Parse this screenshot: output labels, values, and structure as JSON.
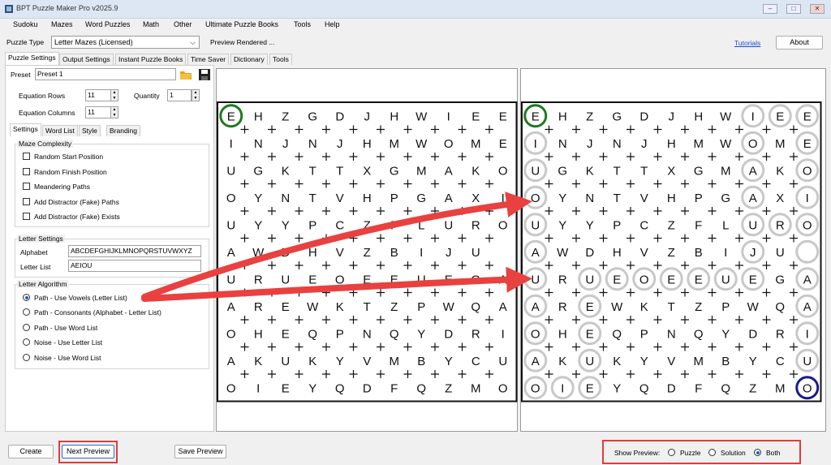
{
  "window": {
    "title": "BPT Puzzle Maker Pro v2025.9",
    "minimize": "‒",
    "maximize": "□",
    "close": "✕"
  },
  "menu": [
    "Sudoku",
    "Mazes",
    "Word Puzzles",
    "Math",
    "Other",
    "Ultimate Puzzle Books",
    "Tools",
    "Help"
  ],
  "toolbar": {
    "puzzle_type_label": "Puzzle Type",
    "puzzle_type_value": "Letter Mazes (Licensed)",
    "status": "Preview Rendered ...",
    "tutorials": "Tutorials",
    "about": "About"
  },
  "main_tabs": [
    "Puzzle Settings",
    "Output Settings",
    "Instant Puzzle Books",
    "Time Saver",
    "Dictionary",
    "Tools"
  ],
  "preset": {
    "label": "Preset",
    "value": "Preset 1"
  },
  "equation": {
    "rows_label": "Equation Rows",
    "rows": "11",
    "cols_label": "Equation Columns",
    "cols": "11",
    "quantity_label": "Quantity",
    "quantity": "1"
  },
  "sub_tabs": [
    "Settings",
    "Word List",
    "Style",
    "Branding"
  ],
  "maze_complexity": {
    "title": "Maze Complexity",
    "options": [
      "Random Start Position",
      "Random Finish Position",
      "Meandering Paths",
      "Add Distractor (Fake) Paths",
      "Add Distractor (Fake) Exists"
    ]
  },
  "letter_settings": {
    "title": "Letter Settings",
    "alphabet_label": "Alphabet",
    "alphabet": "ABCDEFGHIJKLMNOPQRSTUVWXYZ",
    "letter_list_label": "Letter List",
    "letter_list": "AEIOU"
  },
  "letter_algorithm": {
    "title": "Letter Algorithm",
    "options": [
      "Path - Use Vowels (Letter List)",
      "Path - Consonants (Alphabet - Letter List)",
      "Path - Use Word List",
      "Noise - Use Letter List",
      "Noise - Use Word List"
    ],
    "selected": 0
  },
  "bottom": {
    "create": "Create",
    "next_preview": "Next Preview",
    "save_preview": "Save Preview",
    "show_preview_label": "Show Preview:",
    "preview_options": [
      "Puzzle",
      "Solution",
      "Both"
    ],
    "preview_selected": 2
  },
  "grid": [
    "EHZGDJHWIEE",
    "INJNJHMWOME",
    "UGKTTXGMAKO",
    "OYNTVHPGAXI",
    "UYYPCZFLURO",
    "AWDHVZBIJU ",
    "URUEOEEUEGA",
    "AREWKTZPWQA",
    "OHEQPNQYDRI",
    "AKUKYVMBYCU",
    "OIEYQDFQZMO"
  ],
  "solution_path": [
    [
      0,
      0
    ],
    [
      1,
      0
    ],
    [
      2,
      0
    ],
    [
      3,
      0
    ],
    [
      4,
      0
    ],
    [
      5,
      0
    ],
    [
      6,
      0
    ],
    [
      7,
      0
    ],
    [
      8,
      0
    ],
    [
      9,
      0
    ],
    [
      10,
      0
    ],
    [
      10,
      1
    ],
    [
      10,
      2
    ],
    [
      9,
      2
    ],
    [
      8,
      2
    ],
    [
      7,
      2
    ],
    [
      6,
      2
    ],
    [
      6,
      3
    ],
    [
      6,
      4
    ],
    [
      6,
      5
    ],
    [
      6,
      6
    ],
    [
      6,
      7
    ],
    [
      6,
      8
    ],
    [
      5,
      8
    ],
    [
      4,
      8
    ],
    [
      4,
      9
    ],
    [
      3,
      8
    ],
    [
      2,
      8
    ],
    [
      1,
      8
    ],
    [
      0,
      8
    ],
    [
      0,
      9
    ],
    [
      0,
      10
    ],
    [
      1,
      10
    ],
    [
      2,
      10
    ],
    [
      3,
      10
    ],
    [
      4,
      10
    ],
    [
      5,
      10
    ],
    [
      6,
      10
    ],
    [
      7,
      10
    ],
    [
      8,
      10
    ],
    [
      9,
      10
    ],
    [
      10,
      10
    ]
  ],
  "colors": {
    "start": "#1f7a1f",
    "finish": "#1a1a8c",
    "path_circle": "#c8c8c8",
    "arrow": "#e8413f",
    "highlight_box": "#e03c3c",
    "radio_selected": "#1a5fd1"
  }
}
